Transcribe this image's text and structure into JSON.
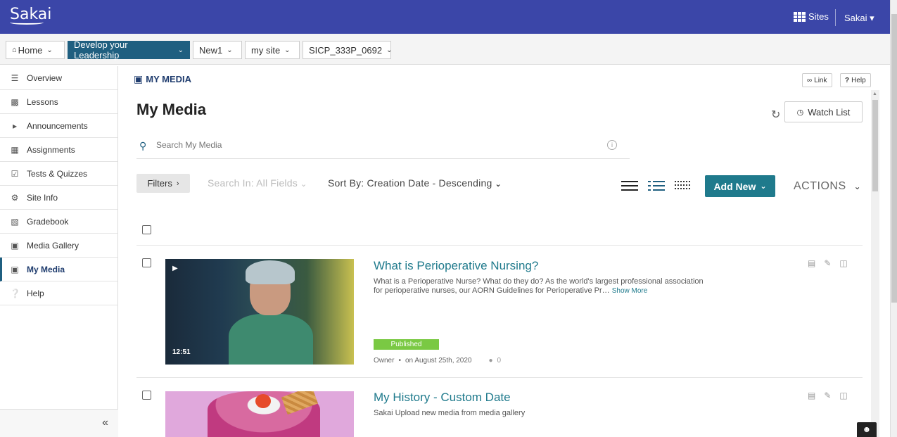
{
  "header": {
    "logo": "Sakai",
    "sites_label": "Sites",
    "user_label": "Sakai ▾"
  },
  "site_nav": [
    {
      "label": "Home",
      "active": false
    },
    {
      "label": "Develop your Leadership",
      "active": true
    },
    {
      "label": "New1",
      "active": false
    },
    {
      "label": "my site",
      "active": false
    },
    {
      "label": "SICP_333P_0692",
      "active": false
    }
  ],
  "sidebar": {
    "items": [
      {
        "label": "Overview",
        "icon": "list-icon"
      },
      {
        "label": "Lessons",
        "icon": "book-icon"
      },
      {
        "label": "Announcements",
        "icon": "megaphone-icon"
      },
      {
        "label": "Assignments",
        "icon": "file-icon"
      },
      {
        "label": "Tests & Quizzes",
        "icon": "checkbox-icon"
      },
      {
        "label": "Site Info",
        "icon": "gear-icon"
      },
      {
        "label": "Gradebook",
        "icon": "gradebook-icon"
      },
      {
        "label": "Media Gallery",
        "icon": "media-icon"
      },
      {
        "label": "My Media",
        "icon": "media-icon",
        "active": true
      },
      {
        "label": "Help",
        "icon": "help-icon"
      }
    ],
    "collapse_label": "«"
  },
  "tool": {
    "title": "MY MEDIA",
    "link_label": "Link",
    "help_label": "Help",
    "page_heading": "My Media",
    "watch_list_label": "Watch List",
    "search_placeholder": "Search My Media",
    "filters_label": "Filters",
    "search_in_label": "Search In: All Fields",
    "sort_by_label": "Sort By: Creation Date - Descending",
    "add_new_label": "Add New",
    "actions_label": "ACTIONS"
  },
  "entries": [
    {
      "title": "What is Perioperative Nursing?",
      "description": "What is a Perioperative Nurse? What do they do? As the world's largest professional association for perioperative nurses, our AORN Guidelines for Perioperative Pr…",
      "show_more": "Show More",
      "duration": "12:51",
      "status": "Published",
      "owner": "Owner",
      "date": "on August 25th, 2020",
      "comments": "0"
    },
    {
      "title": "My History - Custom Date",
      "description": "Sakai Upload new media from media gallery"
    }
  ],
  "colors": {
    "header_bg": "#3b46a8",
    "accent": "#1f7a8c",
    "active_nav": "#1f5f80",
    "published": "#7ac943"
  }
}
